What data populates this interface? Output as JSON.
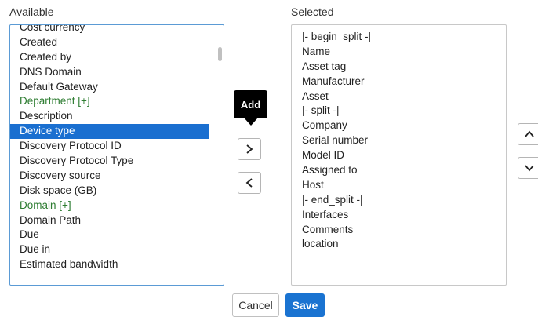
{
  "available": {
    "label": "Available",
    "items": [
      {
        "label": "Cost currency",
        "green": false,
        "selected": false
      },
      {
        "label": "Created",
        "green": false,
        "selected": false
      },
      {
        "label": "Created by",
        "green": false,
        "selected": false
      },
      {
        "label": "DNS Domain",
        "green": false,
        "selected": false
      },
      {
        "label": "Default Gateway",
        "green": false,
        "selected": false
      },
      {
        "label": "Department [+]",
        "green": true,
        "selected": false
      },
      {
        "label": "Description",
        "green": false,
        "selected": false
      },
      {
        "label": "Device type",
        "green": false,
        "selected": true
      },
      {
        "label": "Discovery Protocol ID",
        "green": false,
        "selected": false
      },
      {
        "label": "Discovery Protocol Type",
        "green": false,
        "selected": false
      },
      {
        "label": "Discovery source",
        "green": false,
        "selected": false
      },
      {
        "label": "Disk space (GB)",
        "green": false,
        "selected": false
      },
      {
        "label": "Domain [+]",
        "green": true,
        "selected": false
      },
      {
        "label": "Domain Path",
        "green": false,
        "selected": false
      },
      {
        "label": "Due",
        "green": false,
        "selected": false
      },
      {
        "label": "Due in",
        "green": false,
        "selected": false
      },
      {
        "label": "Estimated bandwidth",
        "green": false,
        "selected": false
      }
    ]
  },
  "selected": {
    "label": "Selected",
    "items": [
      "|- begin_split -|",
      "Name",
      "Asset tag",
      "Manufacturer",
      "Asset",
      "|- split -|",
      "Company",
      "Serial number",
      "Model ID",
      "Assigned to",
      "Host",
      "|- end_split -|",
      "Interfaces",
      "Comments",
      "location"
    ]
  },
  "tooltip": {
    "text": "Add"
  },
  "controls": {
    "add_icon": "chevron-right-icon",
    "remove_icon": "chevron-left-icon",
    "up_icon": "chevron-up-icon",
    "down_icon": "chevron-down-icon"
  },
  "footer": {
    "cancel_label": "Cancel",
    "save_label": "Save"
  },
  "colors": {
    "accent": "#1a73d1",
    "green": "#2e7d32",
    "selection": "#1a6fd0"
  }
}
